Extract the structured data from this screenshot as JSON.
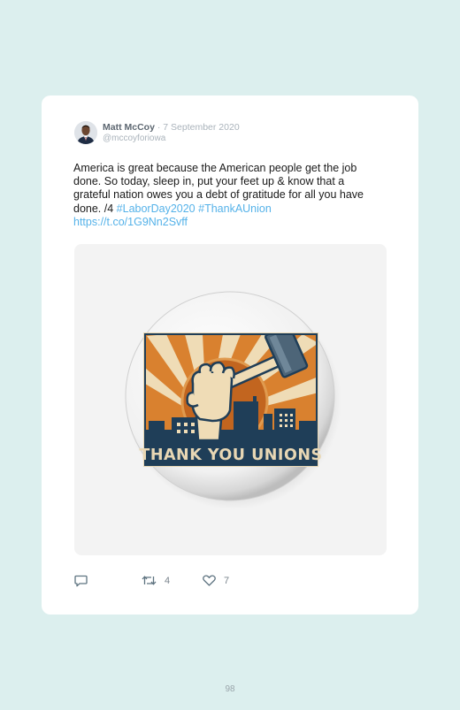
{
  "tweet": {
    "author_name": "Matt McCoy",
    "separator": "·",
    "date": "7 September 2020",
    "handle": "@mccoyforiowa",
    "text_line1": "America is great because the American people get the job",
    "text_line2": "done. So today, sleep in, put your feet up & know that a",
    "text_line3": "grateful nation owes you a debt of gratitude for all you have",
    "text_line4": "done. /4",
    "hashtag1": "#LaborDay2020",
    "hashtag2": "#ThankAUnion",
    "url": "https://t.co/1G9Nn2Svff",
    "media": {
      "button_text": "THANK YOU UNIONS",
      "colors": {
        "navy": "#1f3e58",
        "orange": "#d9812f",
        "cream": "#f0e2c2",
        "steel": "#4d6578"
      }
    },
    "actions": {
      "reply_icon": "reply-icon",
      "retweet_icon": "retweet-icon",
      "retweet_count": "4",
      "like_icon": "heart-icon",
      "like_count": "7"
    }
  },
  "page": {
    "number": "98"
  },
  "colors": {
    "background": "#dcefee",
    "card": "#ffffff",
    "link": "#55b2e9"
  }
}
